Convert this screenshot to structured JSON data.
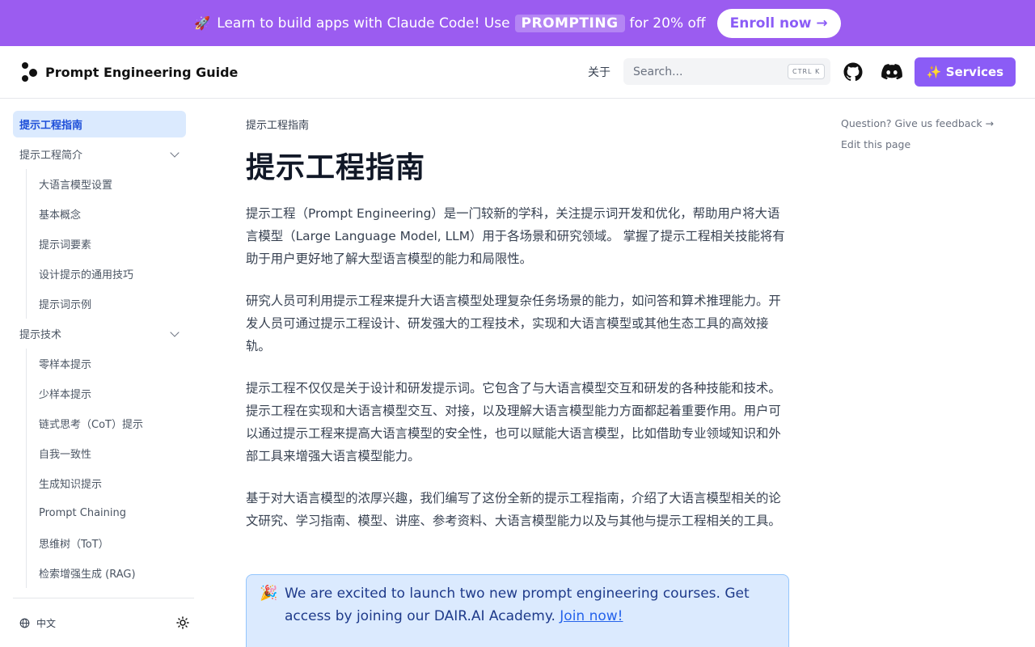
{
  "banner": {
    "emoji": "🚀",
    "text_before": "Learn to build apps with Claude Code! Use",
    "promo_code": "PROMPTING",
    "text_after": "for 20% off",
    "cta": "Enroll now →"
  },
  "header": {
    "logo_title": "Prompt Engineering Guide",
    "nav_about": "关于",
    "search_placeholder": "Search...",
    "search_shortcut": "CTRL K",
    "github_icon": "github-icon",
    "discord_icon": "discord-icon",
    "services_label": "✨ Services"
  },
  "sidebar": {
    "items": [
      {
        "label": "提示工程指南",
        "active": true
      },
      {
        "label": "提示工程简介",
        "expandable": true
      },
      {
        "label": "大语言模型设置",
        "child": true
      },
      {
        "label": "基本概念",
        "child": true
      },
      {
        "label": "提示词要素",
        "child": true
      },
      {
        "label": "设计提示的通用技巧",
        "child": true
      },
      {
        "label": "提示词示例",
        "child": true
      },
      {
        "label": "提示技术",
        "expandable": true
      },
      {
        "label": "零样本提示",
        "child": true
      },
      {
        "label": "少样本提示",
        "child": true
      },
      {
        "label": "链式思考（CoT）提示",
        "child": true
      },
      {
        "label": "自我一致性",
        "child": true
      },
      {
        "label": "生成知识提示",
        "child": true
      },
      {
        "label": "Prompt Chaining",
        "child": true
      },
      {
        "label": "思维树（ToT）",
        "child": true
      },
      {
        "label": "检索增强生成 (RAG)",
        "child": true
      }
    ],
    "footer": {
      "language": "中文",
      "globe_icon": "globe-icon",
      "theme_icon": "sun-icon"
    }
  },
  "main": {
    "breadcrumb": "提示工程指南",
    "title": "提示工程指南",
    "paragraphs": [
      "提示工程（Prompt Engineering）是一门较新的学科，关注提示词开发和优化，帮助用户将大语言模型（Large Language Model, LLM）用于各场景和研究领域。 掌握了提示工程相关技能将有助于用户更好地了解大型语言模型的能力和局限性。",
      "研究人员可利用提示工程来提升大语言模型处理复杂任务场景的能力，如问答和算术推理能力。开发人员可通过提示工程设计、研发强大的工程技术，实现和大语言模型或其他生态工具的高效接轨。",
      "提示工程不仅仅是关于设计和研发提示词。它包含了与大语言模型交互和研发的各种技能和技术。提示工程在实现和大语言模型交互、对接，以及理解大语言模型能力方面都起着重要作用。用户可以通过提示工程来提高大语言模型的安全性，也可以赋能大语言模型，比如借助专业领域知识和外部工具来增强大语言模型能力。",
      "基于对大语言模型的浓厚兴趣，我们编写了这份全新的提示工程指南，介绍了大语言模型相关的论文研究、学习指南、模型、讲座、参考资料、大语言模型能力以及与其他与提示工程相关的工具。"
    ],
    "callout": {
      "emoji": "🎉",
      "text": "We are excited to launch two new prompt engineering courses. Get access by joining our DAIR.AI Academy.",
      "link": "Join now!"
    }
  },
  "toc": {
    "feedback": "Question? Give us feedback →",
    "edit": "Edit this page"
  },
  "colors": {
    "banner": "#9b5cf0",
    "accent": "#8b5cf6",
    "active_bg": "#dbeafe",
    "active_text": "#1d4ed8"
  }
}
